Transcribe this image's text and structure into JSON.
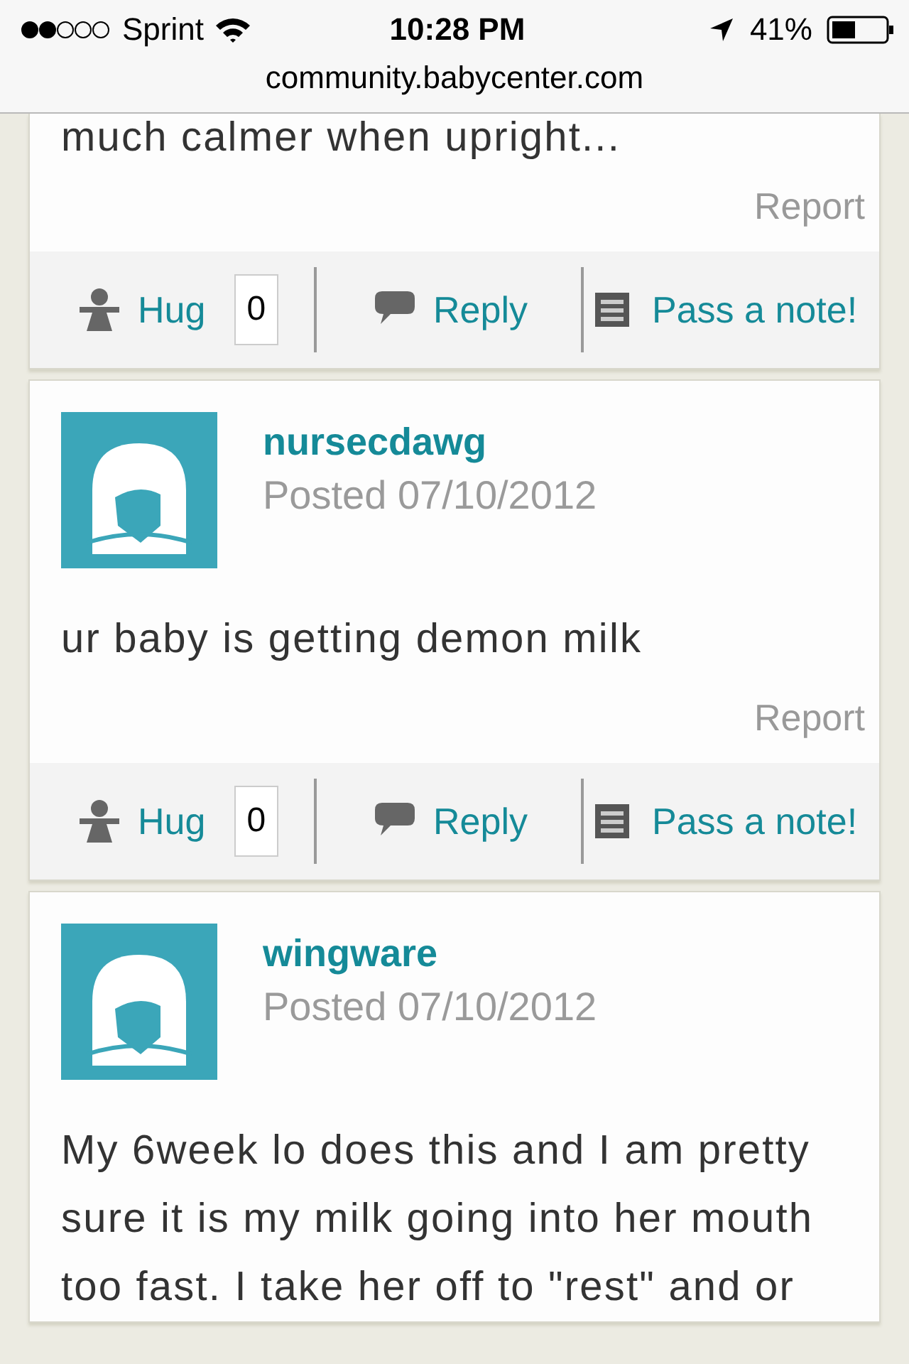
{
  "status_bar": {
    "carrier": "Sprint",
    "time": "10:28 PM",
    "battery": "41%"
  },
  "address_bar": {
    "url": "community.babycenter.com"
  },
  "posts": [
    {
      "body": [
        "much calmer when upright..."
      ],
      "report": "Report",
      "hug": "Hug",
      "hug_count": "0",
      "reply": "Reply",
      "note": "Pass a note!"
    },
    {
      "author": "nursecdawg",
      "posted": "Posted 07/10/2012",
      "body": [
        "ur baby is getting demon milk"
      ],
      "report": "Report",
      "hug": "Hug",
      "hug_count": "0",
      "reply": "Reply",
      "note": "Pass a note!"
    },
    {
      "author": "wingware",
      "posted": "Posted 07/10/2012",
      "body": [
        "My 6week lo does this and I am pretty sure it is my milk going into her mouth too fast. I take her off to \"rest\" and or"
      ]
    }
  ]
}
